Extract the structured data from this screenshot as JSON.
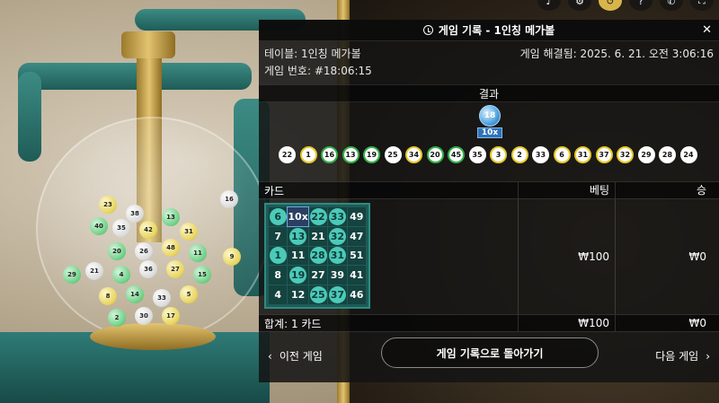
{
  "toolbar": {
    "icons": [
      "speaker-icon",
      "gear-icon",
      "history-icon",
      "info-icon",
      "phone-icon",
      "fullscreen-icon"
    ]
  },
  "panel": {
    "title": "게임 기록 - 1인칭 메가볼",
    "close": "✕",
    "table_label": "테이블: 1인칭 메가볼",
    "settled_label": "게임 해결됨: 2025. 6. 21. 오전 3:06:16",
    "game_number_label": "게임 번호: #18:06:15",
    "result_header": "결과",
    "megaball": {
      "number": "18",
      "multiplier": "10x"
    },
    "drawn_balls": [
      {
        "n": "22",
        "c": "white"
      },
      {
        "n": "1",
        "c": "yellow"
      },
      {
        "n": "16",
        "c": "green"
      },
      {
        "n": "13",
        "c": "green"
      },
      {
        "n": "19",
        "c": "green"
      },
      {
        "n": "25",
        "c": "white"
      },
      {
        "n": "34",
        "c": "yellow"
      },
      {
        "n": "20",
        "c": "green"
      },
      {
        "n": "45",
        "c": "green"
      },
      {
        "n": "35",
        "c": "white"
      },
      {
        "n": "3",
        "c": "yellow"
      },
      {
        "n": "2",
        "c": "yellow"
      },
      {
        "n": "33",
        "c": "white"
      },
      {
        "n": "6",
        "c": "yellow"
      },
      {
        "n": "31",
        "c": "yellow"
      },
      {
        "n": "37",
        "c": "yellow"
      },
      {
        "n": "32",
        "c": "yellow"
      },
      {
        "n": "29",
        "c": "white"
      },
      {
        "n": "28",
        "c": "white"
      },
      {
        "n": "24",
        "c": "white"
      }
    ],
    "columns": {
      "card": "카드",
      "bet": "베팅",
      "win": "승"
    },
    "card": [
      [
        "6",
        "10x",
        "22",
        "33",
        "49"
      ],
      [
        "7",
        "13",
        "21",
        "32",
        "47"
      ],
      [
        "1",
        "11",
        "28",
        "31",
        "51"
      ],
      [
        "8",
        "19",
        "27",
        "39",
        "41"
      ],
      [
        "4",
        "12",
        "25",
        "37",
        "46"
      ]
    ],
    "card_marked": [
      [
        true,
        false,
        true,
        true,
        false
      ],
      [
        false,
        true,
        false,
        true,
        false
      ],
      [
        true,
        false,
        true,
        true,
        false
      ],
      [
        false,
        true,
        false,
        false,
        false
      ],
      [
        false,
        false,
        true,
        true,
        false
      ]
    ],
    "row_bet": "₩100",
    "row_win": "₩0",
    "total_label": "합계: 1 카드",
    "total_bet": "₩100",
    "total_win": "₩0",
    "nav": {
      "prev": "이전 게임",
      "back": "게임 기록으로 돌아가기",
      "next": "다음 게임"
    }
  },
  "colors": {
    "panel_bg": "#141414",
    "card_bg": "#1f5b57",
    "marked": "#4ccab9",
    "megaball": "#4fa3de",
    "ball_yellow": "#e6c928",
    "ball_green": "#33b04a"
  }
}
